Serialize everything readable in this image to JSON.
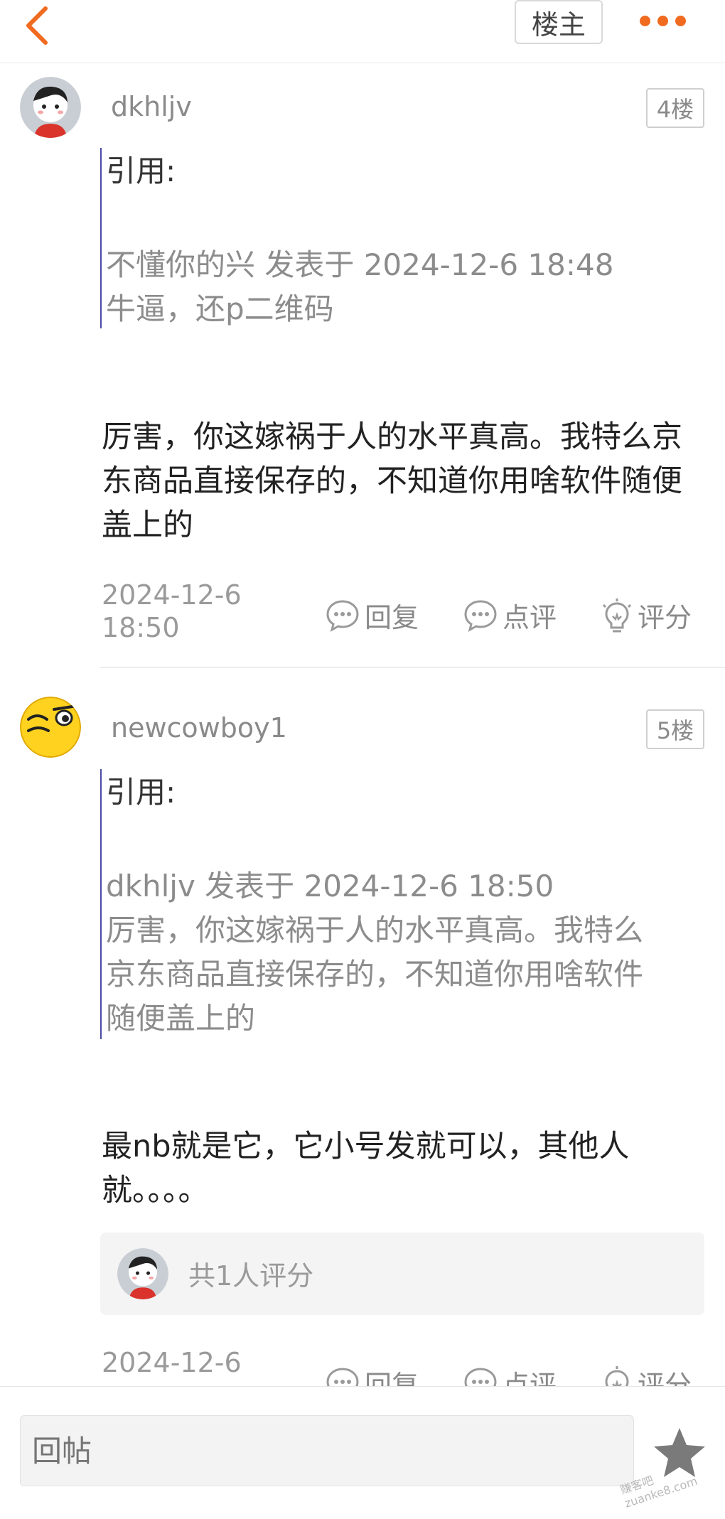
{
  "header": {
    "op_label": "楼主"
  },
  "posts": [
    {
      "username": "dkhljv",
      "floor": "4楼",
      "quote_title": "引用:",
      "quote_meta": "不懂你的兴 发表于 2024-12-6 18:48",
      "quote_text": "牛逼，还p二维码",
      "content": "厉害，你这嫁祸于人的水平真高。我特么京东商品直接保存的，不知道你用啥软件随便盖上的",
      "time": "2024-12-6\n18:50",
      "actions": {
        "reply": "回复",
        "comment": "点评",
        "rate": "评分"
      }
    },
    {
      "username": "newcowboy1",
      "floor": "5楼",
      "quote_title": "引用:",
      "quote_meta": "dkhljv 发表于 2024-12-6 18:50",
      "quote_text": "厉害，你这嫁祸于人的水平真高。我特么\n京东商品直接保存的，不知道你用啥软件\n随便盖上的",
      "content": "最nb就是它，它小号发就可以，其他人就。。。。",
      "rating": "共1人评分",
      "time": "2024-12-6",
      "actions": {
        "reply": "回复",
        "comment": "点评",
        "rate": "评分"
      }
    }
  ],
  "footer": {
    "reply_placeholder": "回帖",
    "watermark": "赚客吧 zuanke8.com"
  },
  "colors": {
    "accent": "#f06a1f",
    "quote_bar": "#4a4aa8"
  }
}
